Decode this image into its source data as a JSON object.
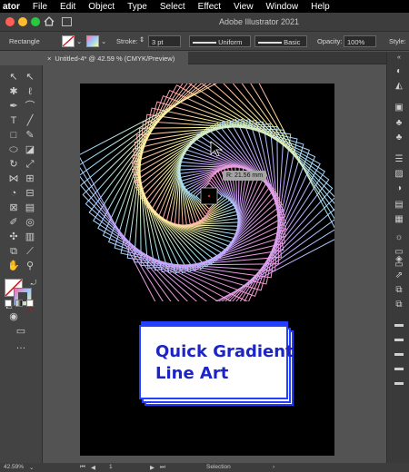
{
  "menubar": {
    "app": "ator",
    "items": [
      "File",
      "Edit",
      "Object",
      "Type",
      "Select",
      "Effect",
      "View",
      "Window",
      "Help"
    ]
  },
  "titlebar": {
    "title": "Adobe Illustrator 2021"
  },
  "controlbar": {
    "tool_label": "Rectangle",
    "stroke_label": "Stroke:",
    "stroke_value": "3 pt",
    "profile": "Uniform",
    "brush": "Basic",
    "opacity_label": "Opacity:",
    "opacity_value": "100%",
    "style_label": "Style:"
  },
  "document_tab": {
    "label": "Untitled-4* @ 42.59 % (CMYK/Preview)"
  },
  "canvas": {
    "tooltip": "R: 21.56 mm",
    "card_text_line1": "Quick Gradient",
    "card_text_line2": "Line Art"
  },
  "statusbar": {
    "zoom": "42.59%",
    "page": "1",
    "mode": "Selection"
  },
  "colors": {
    "menubar": "#000000",
    "panel": "#434343",
    "canvas": "#535353",
    "artboard": "#000000",
    "card_accent": "#2340ff",
    "card_text": "#1c24c8"
  }
}
